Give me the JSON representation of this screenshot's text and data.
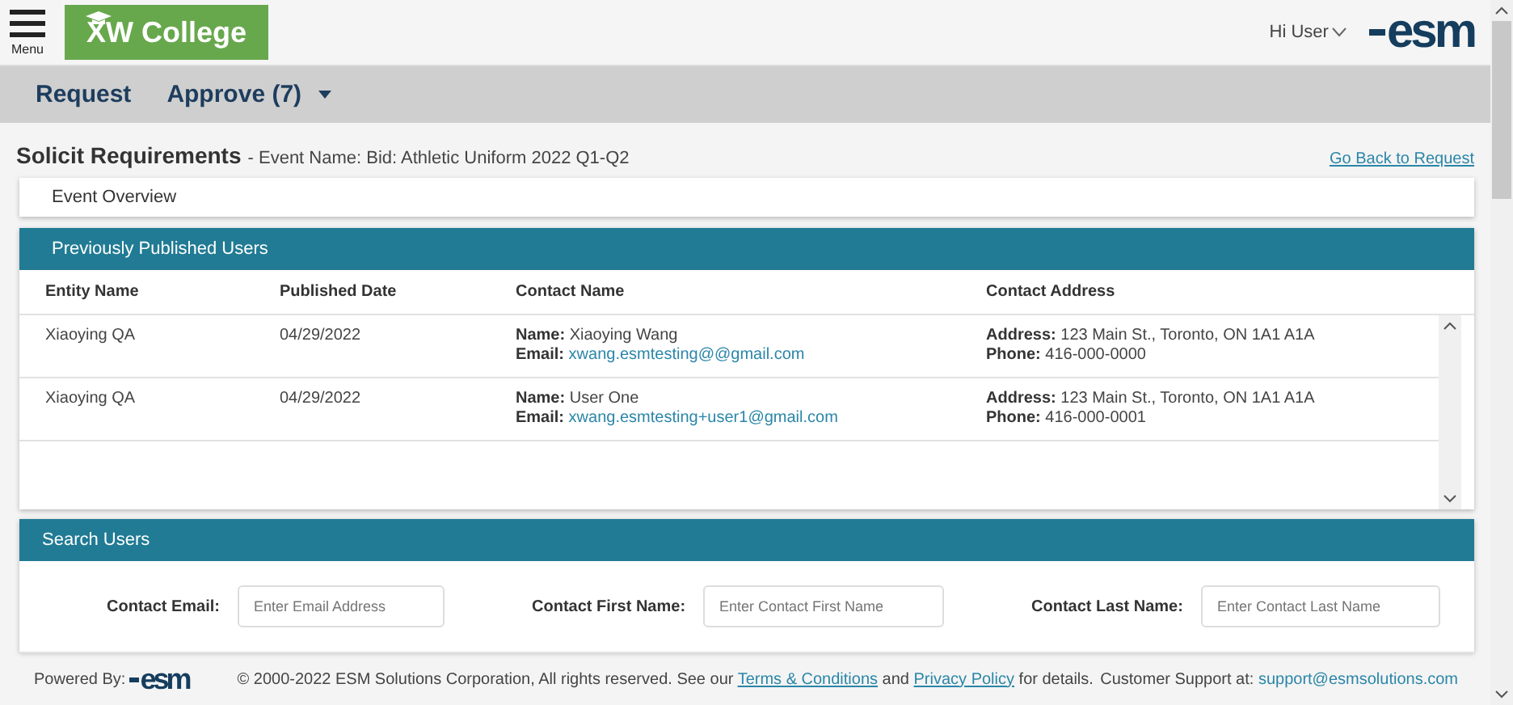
{
  "header": {
    "menu_label": "Menu",
    "college_logo": "XW College",
    "user_menu": "Hi User",
    "brand_logo": "esm"
  },
  "nav": [
    {
      "label": "Request",
      "dropdown": false
    },
    {
      "label": "Approve (7)",
      "dropdown": true
    }
  ],
  "page": {
    "title": "Solicit Requirements",
    "subtitle": "- Event Name: Bid: Athletic Uniform 2022 Q1-Q2",
    "back_link": "Go Back to Request"
  },
  "event_overview": {
    "label": "Event Overview"
  },
  "published_users": {
    "title": "Previously Published Users",
    "columns": [
      "Entity Name",
      "Published Date",
      "Contact Name",
      "Contact Address"
    ],
    "rows": [
      {
        "entity": "Xiaoying QA",
        "date": "04/29/2022",
        "name": "**Name:** Xiaoying Wang",
        "email_label": "Email:",
        "email": "xwang.esmtesting@@gmail.com",
        "address": "**Address:** 123 Main St., Toronto, ON 1A1 A1A",
        "phone": "**Phone:** 416-000-0000"
      },
      {
        "entity": "Xiaoying QA",
        "date": "04/29/2022",
        "name": "**Name:** User One",
        "email_label": "Email:",
        "email": "xwang.esmtesting+user1@gmail.com",
        "address": "**Address:** 123 Main St., Toronto, ON 1A1 A1A",
        "phone": "**Phone:** 416-000-0001"
      }
    ]
  },
  "search_users": {
    "title": "Search Users",
    "fields": [
      {
        "label": "Contact Email:",
        "placeholder": "Enter Email Address"
      },
      {
        "label": "Contact First Name:",
        "placeholder": "Enter Contact First Name"
      },
      {
        "label": "Contact Last Name:",
        "placeholder": "Enter Contact Last Name"
      }
    ]
  },
  "footer": {
    "powered_by": "Powered By:",
    "brand_logo": "esm",
    "copyright": "© 2000-2022 ESM Solutions Corporation, All rights reserved. See our",
    "terms_link": "Terms & Conditions",
    "and": "and",
    "privacy_link": "Privacy Policy",
    "details": "for details.",
    "support_label": "Customer Support at:",
    "support_email": "support@esmsolutions.com"
  }
}
